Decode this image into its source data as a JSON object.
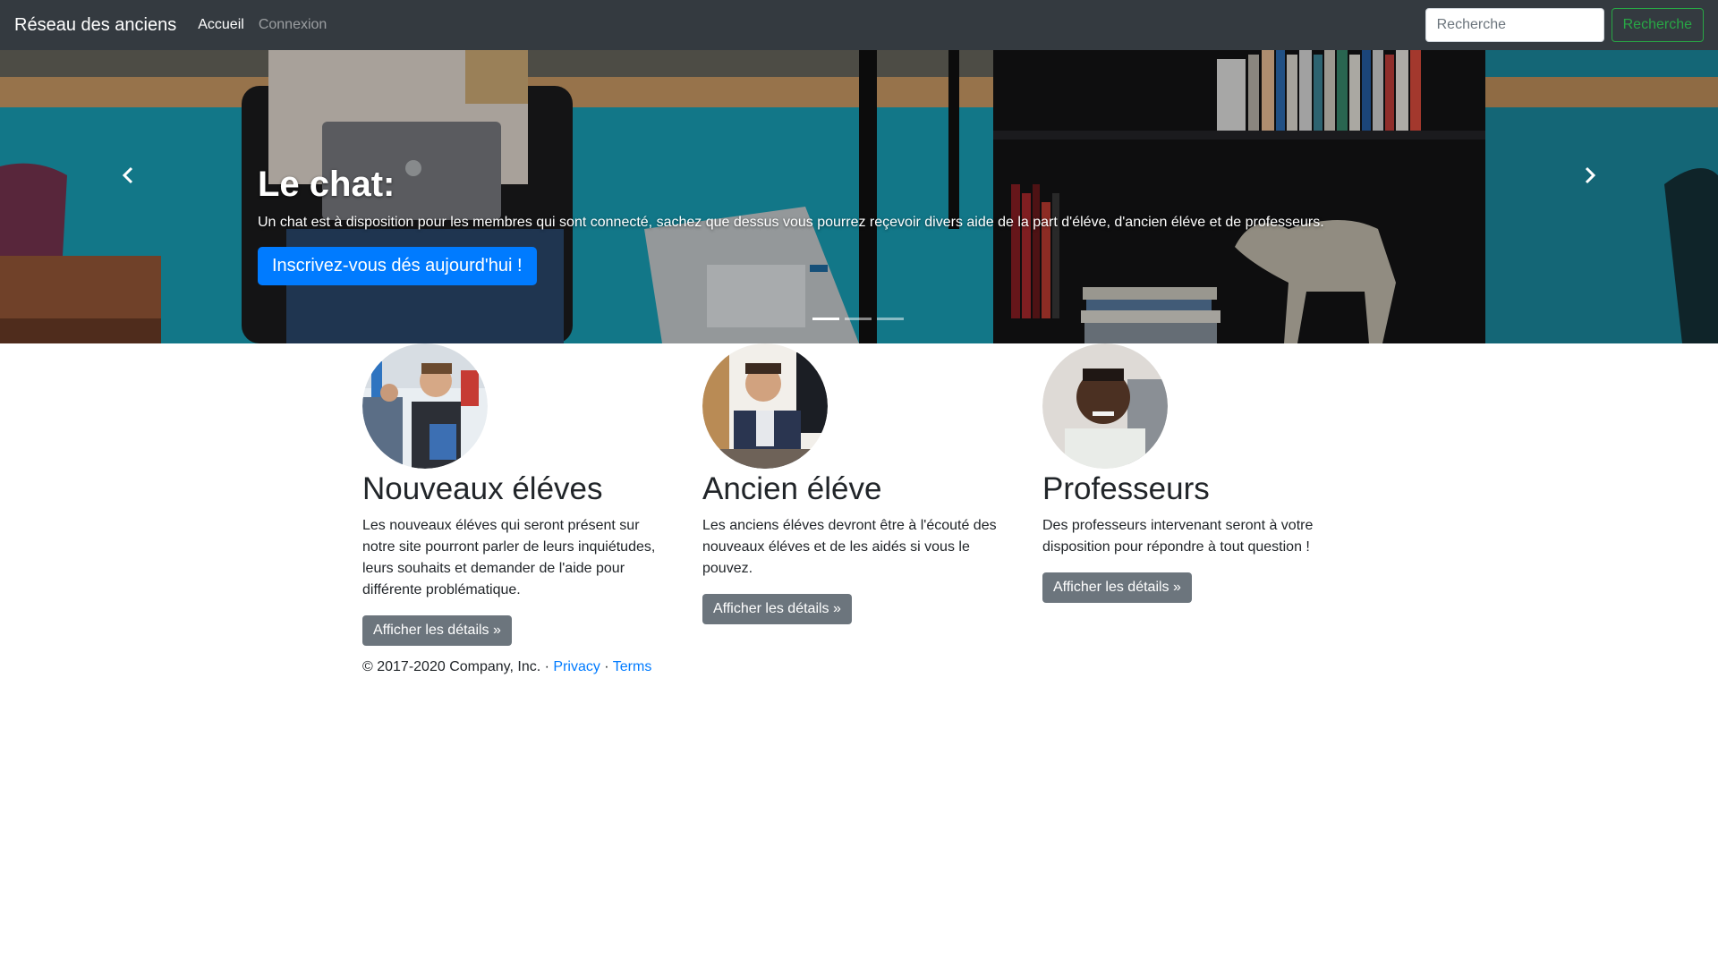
{
  "navbar": {
    "brand": "Réseau des anciens",
    "links": [
      "Accueil",
      "Connexion"
    ],
    "search_placeholder": "Recherche",
    "search_button": "Recherche"
  },
  "carousel": {
    "title": "Le chat:",
    "text": "Un chat est à disposition pour les membres qui sont connecté, sachez que dessus vous pourrez reçevoir divers aide de la part d'éléve, d'ancien éléve et de professeurs.",
    "button": "Inscrivez-vous dés aujourd'hui !",
    "slide_count": 3,
    "active_slide": 1
  },
  "features": [
    {
      "title": "Nouveaux éléves",
      "text": "Les nouveaux éléves qui seront présent sur notre site pourront parler de leurs inquiétudes, leurs souhaits et demander de l'aide pour différente problématique.",
      "button": "Afficher les détails »"
    },
    {
      "title": "Ancien éléve",
      "text": "Les anciens éléves devront être à l'écouté des nouveaux éléves et de les aidés si vous le pouvez.",
      "button": "Afficher les détails »"
    },
    {
      "title": "Professeurs",
      "text": "Des professeurs intervenant seront à votre disposition pour répondre à tout question !",
      "button": "Afficher les détails »"
    }
  ],
  "footer": {
    "copyright": "© 2017-2020 Company, Inc. ·",
    "privacy": "Privacy",
    "separator": "·",
    "terms": "Terms"
  },
  "colors": {
    "navbar_bg": "#343a40",
    "primary": "#007bff",
    "success": "#28a745",
    "secondary": "#6c757d"
  }
}
